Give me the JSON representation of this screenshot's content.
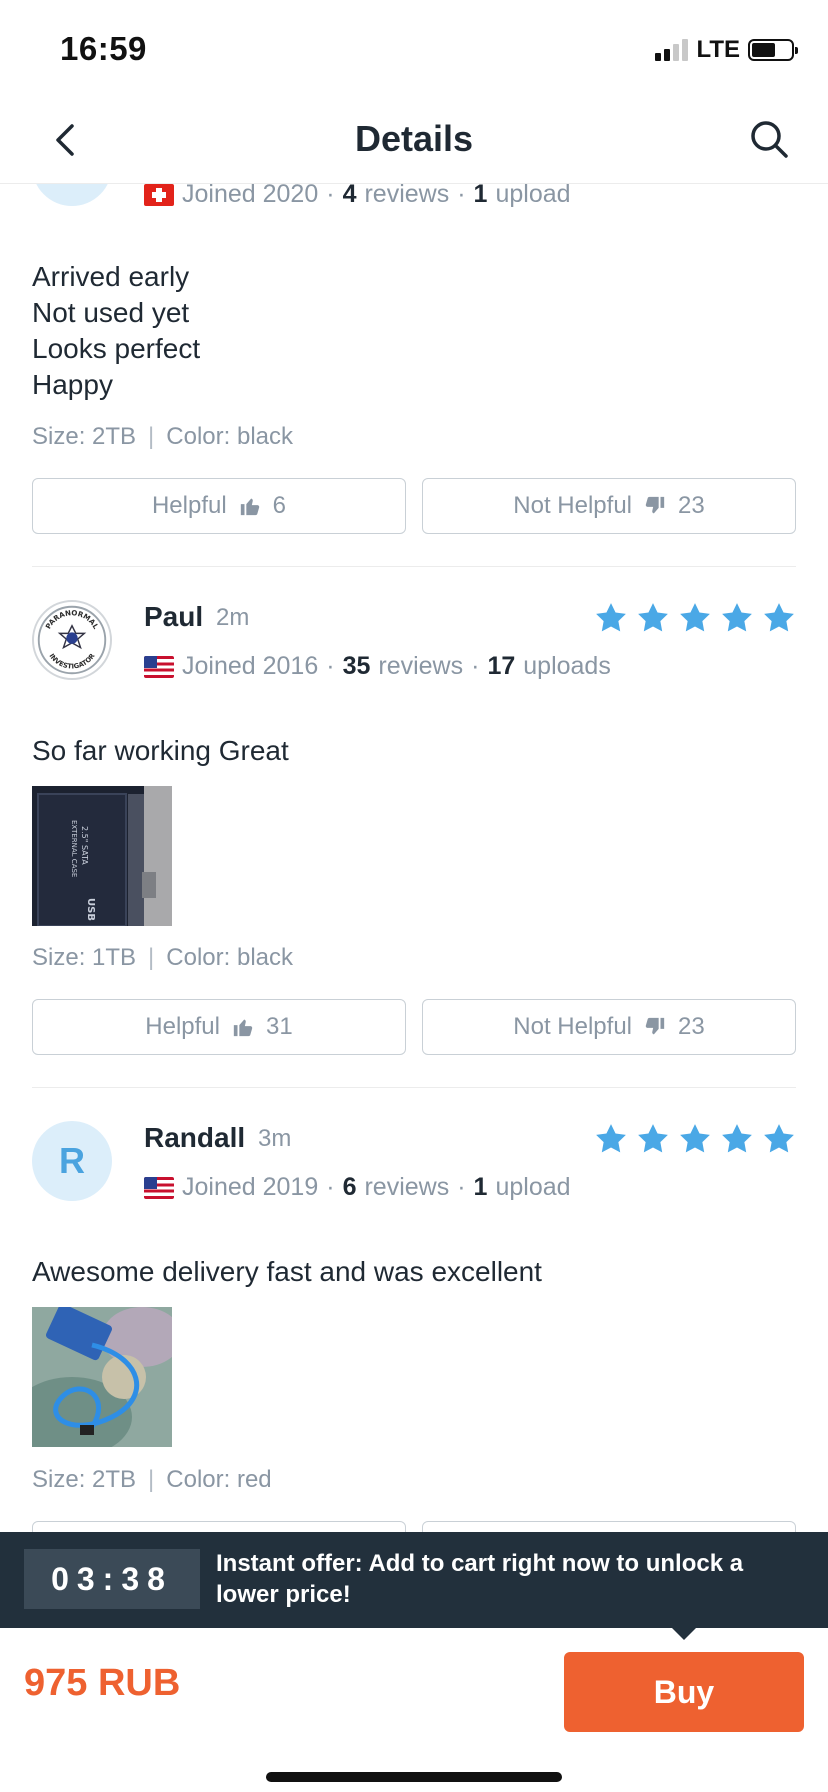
{
  "status_bar": {
    "time": "16:59",
    "network": "LTE"
  },
  "nav": {
    "title": "Details"
  },
  "reviews": [
    {
      "flag": "ch",
      "joined": "Joined 2020",
      "review_count": "4",
      "reviews_label": "reviews",
      "upload_count": "1",
      "uploads_label": "upload",
      "body_lines": [
        "Arrived early",
        "Not used yet",
        "Looks perfect",
        "Happy"
      ],
      "size": "Size: 2TB",
      "color": "Color: black",
      "helpful_label": "Helpful",
      "helpful_count": "6",
      "not_helpful_label": "Not Helpful",
      "not_helpful_count": "23"
    },
    {
      "name": "Paul",
      "time": "2m",
      "avatar_text": [
        "PARANORMAL",
        "INVESTIGATOR"
      ],
      "rating": 5,
      "flag": "us",
      "joined": "Joined 2016",
      "review_count": "35",
      "reviews_label": "reviews",
      "upload_count": "17",
      "uploads_label": "uploads",
      "body": "So far working Great",
      "photo_text": [
        "2.5\" SATA",
        "EXTERNAL CASE",
        "USB"
      ],
      "size": "Size: 1TB",
      "color": "Color: black",
      "helpful_label": "Helpful",
      "helpful_count": "31",
      "not_helpful_label": "Not Helpful",
      "not_helpful_count": "23"
    },
    {
      "name": "Randall",
      "time": "3m",
      "avatar_letter": "R",
      "rating": 5,
      "flag": "us",
      "joined": "Joined 2019",
      "review_count": "6",
      "reviews_label": "reviews",
      "upload_count": "1",
      "uploads_label": "upload",
      "body": "Awesome delivery fast and was excellent",
      "size": "Size: 2TB",
      "color": "Color: red"
    }
  ],
  "offer": {
    "timer_digits": "03:38",
    "message": "Instant offer: Add to cart right now to unlock a lower price!"
  },
  "purchase": {
    "price": "975 RUB",
    "buy_label": "Buy"
  },
  "colors": {
    "accent": "#ee6130",
    "star": "#4aa8e6",
    "banner": "#22303c"
  }
}
